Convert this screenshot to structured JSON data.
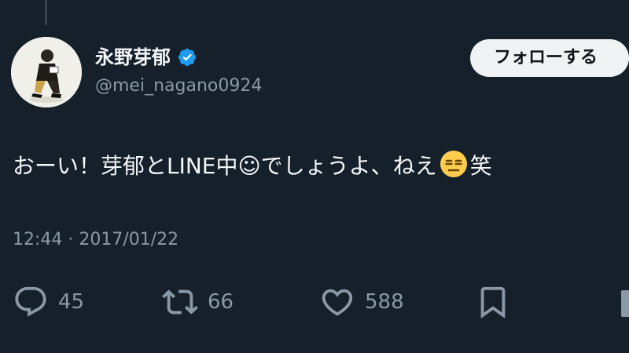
{
  "user": {
    "display_name": "永野芽郁",
    "handle": "@mei_nagano0924",
    "verified": true,
    "verified_color": "#1d9bf0"
  },
  "follow_button": {
    "label": "フォローする"
  },
  "tweet": {
    "text_part1": "おーい！芽郁とLINE中☺でしょうよ、ねえ",
    "emoji": "expressionless-face-emoji",
    "text_part2": "笑",
    "timestamp": "12:44 · 2017/01/22"
  },
  "actions": {
    "reply_count": "45",
    "retweet_count": "66",
    "like_count": "588"
  },
  "colors": {
    "background": "#15202b",
    "primary_text": "#f5f8fa",
    "secondary_text": "#8b98a5",
    "button_bg": "#eff3f4"
  }
}
